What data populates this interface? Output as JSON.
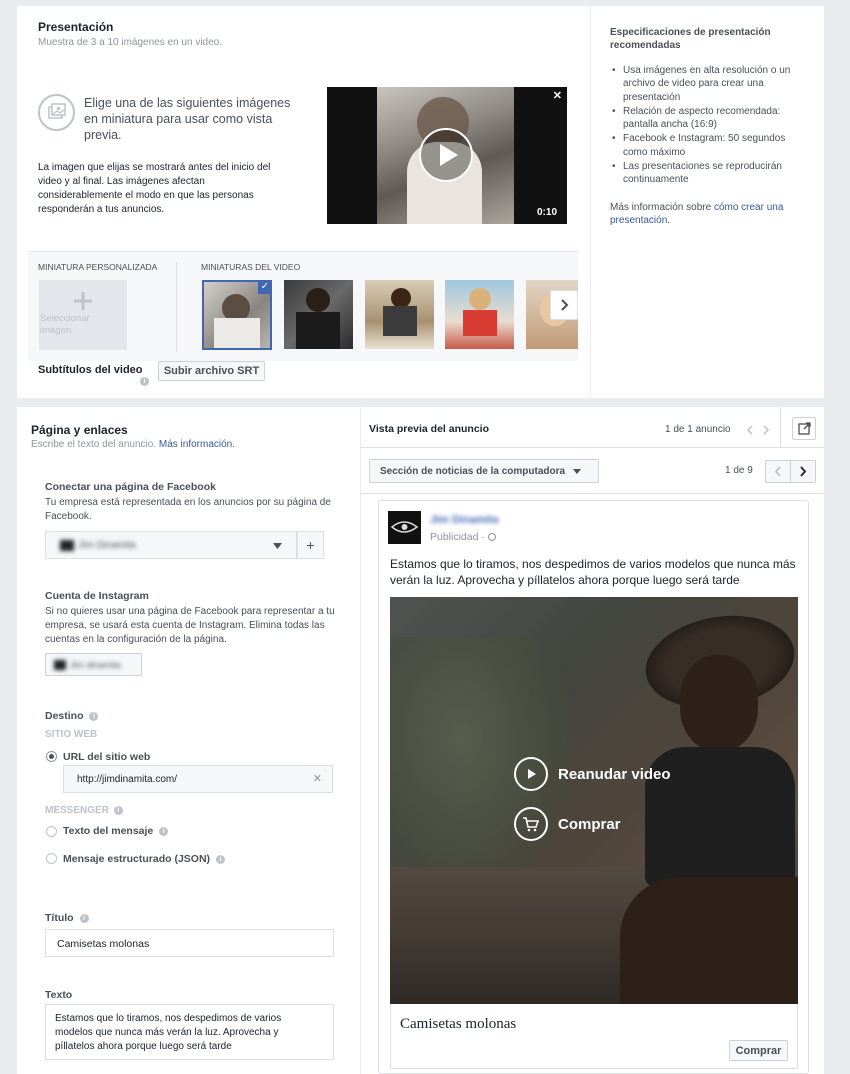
{
  "presentacion": {
    "title": "Presentación",
    "subtitle": "Muestra de 3 a 10 imágenes en un video.",
    "choose_text": "Elige una de las siguientes imágenes en miniatura para usar como vista previa.",
    "info_text": "La imagen que elijas se mostrará antes del inicio del video y al final. Las imágenes afectan considerablemente el modo en que las personas responderán a tus anuncios.",
    "video_duration": "0:10",
    "close_glyph": "✕",
    "custom_thumb_label": "MINIATURA PERSONALIZADA",
    "select_image_label": "Seleccionar imagen",
    "video_thumbs_label": "MINIATURAS DEL VIDEO",
    "subtitles_label": "Subtítulos del video",
    "upload_srt_label": "Subir archivo SRT"
  },
  "specs": {
    "title": "Especificaciones de presentación recomendadas",
    "items": [
      "Usa imágenes en alta resolución o un archivo de video para crear una presentación",
      "Relación de aspecto recomendada: pantalla ancha (16:9)",
      "Facebook e Instagram: 50 segundos como máximo",
      "Las presentaciones se reproducirán continuamente"
    ],
    "more_prefix": "Más información sobre ",
    "more_link": "cómo crear una presentación",
    "more_suffix": "."
  },
  "pagina": {
    "title": "Página y enlaces",
    "subtitle_prefix": "Escribe el texto del anuncio. ",
    "subtitle_link": "Más información.",
    "fb_title": "Conectar una página de Facebook",
    "fb_desc": "Tu empresa está representada en los anuncios por su página de Facebook.",
    "fb_page_name": "Jim Dinamita",
    "plus_glyph": "+",
    "ig_title": "Cuenta de Instagram",
    "ig_desc": "Si no quieres usar una página de Facebook para representar a tu empresa, se usará esta cuenta de Instagram. Elimina todas las cuentas en la configuración de la página.",
    "ig_account_name": "Jim dinamita",
    "destino_title": "Destino",
    "sitio_web_label": "SITIO WEB",
    "url_option": "URL del sitio web",
    "url_value": "http://jimdinamita.com/",
    "messenger_label": "MESSENGER",
    "msg_option_1": "Texto del mensaje",
    "msg_option_2": "Mensaje estructurado (JSON)",
    "titulo_label": "Título",
    "titulo_value": "Camisetas molonas",
    "texto_label": "Texto",
    "texto_value": "Estamos que lo tiramos, nos despedimos de varios modelos que nunca más verán la luz. Aprovecha y píllatelos ahora porque luego será tarde"
  },
  "preview": {
    "title": "Vista previa del anuncio",
    "count": "1 de 1 anuncio",
    "placement": "Sección de noticias de la computadora",
    "pager": "1 de 9",
    "page_name": "Jim Dinamita",
    "sponsored": "Publicidad",
    "post_text": "Estamos que lo tiramos, nos despedimos de varios modelos que nunca más verán la luz. Aprovecha y píllatelos ahora porque luego será tarde",
    "resume_label": "Reanudar video",
    "buy_label": "Comprar",
    "headline": "Camisetas molonas",
    "cta_label": "Comprar"
  },
  "colors": {
    "accent": "#4267b2",
    "link": "#365899"
  }
}
